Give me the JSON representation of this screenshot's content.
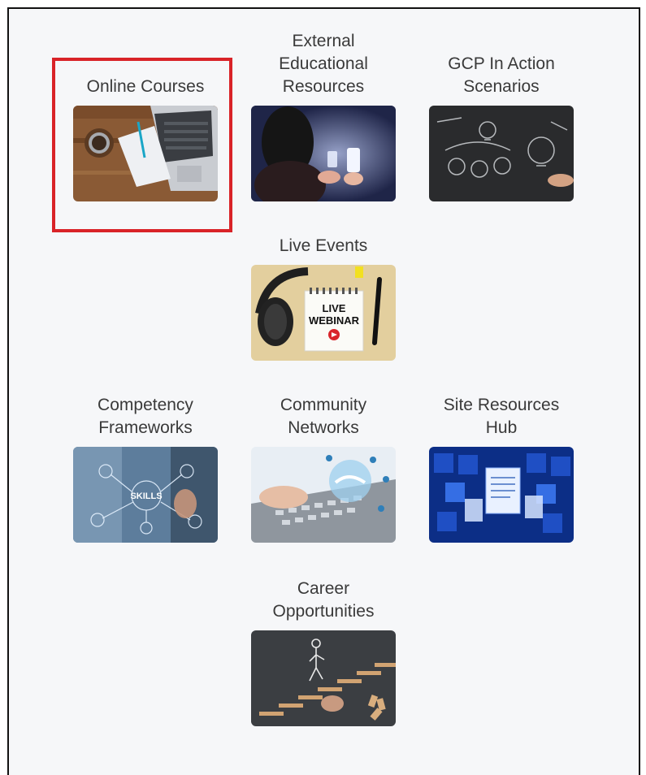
{
  "tiles": [
    {
      "id": "online-courses",
      "label": "Online Courses",
      "image": "laptop-coffee-notepad-image",
      "selected": true
    },
    {
      "id": "external-educational-resources",
      "label": "External\nEducational\nResources",
      "image": "person-holding-phone-image",
      "selected": false
    },
    {
      "id": "gcp-in-action-scenarios",
      "label": "GCP In Action\nScenarios",
      "image": "chalkboard-lightbulbs-image",
      "selected": false
    },
    {
      "id": "live-events",
      "label": "Live Events",
      "image": "live-webinar-notepad-image",
      "selected": false,
      "image_text_1": "LIVE",
      "image_text_2": "WEBINAR"
    },
    {
      "id": "competency-frameworks",
      "label": "Competency\nFrameworks",
      "image": "skills-network-image",
      "selected": false,
      "image_text_1": "SKILLS"
    },
    {
      "id": "community-networks",
      "label": "Community\nNetworks",
      "image": "keyboard-handshake-image",
      "selected": false
    },
    {
      "id": "site-resources-hub",
      "label": "Site Resources\nHub",
      "image": "blue-documents-image",
      "selected": false
    },
    {
      "id": "career-opportunities",
      "label": "Career\nOpportunities",
      "image": "stairs-career-image",
      "selected": false
    }
  ],
  "colors": {
    "highlight": "#d92328",
    "label": "#3a3a3a",
    "background": "#f6f7f9"
  }
}
